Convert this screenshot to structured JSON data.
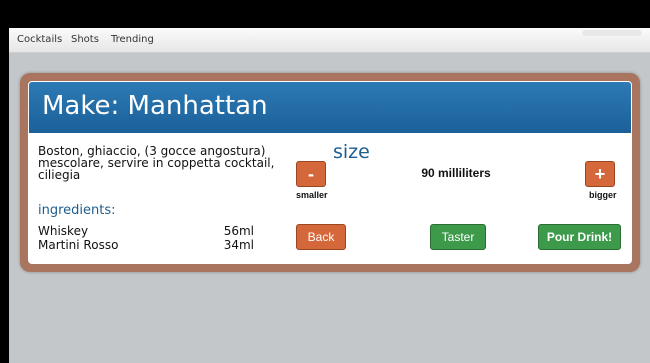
{
  "nav": {
    "items": [
      "Cocktails",
      "Shots",
      "Trending"
    ]
  },
  "drink": {
    "title": "Make: Manhattan",
    "directions": "Boston, ghiaccio, (3 gocce angostura) mescolare, servire in coppetta cocktail, ciliegia",
    "ingredients_heading": "ingredients:",
    "ingredients": [
      {
        "name": "Whiskey",
        "qty": "56ml"
      },
      {
        "name": "Martini Rosso",
        "qty": "34ml"
      }
    ]
  },
  "size": {
    "label": "size",
    "value": "90 milliliters",
    "decrease": {
      "symbol": "-",
      "caption": "smaller"
    },
    "increase": {
      "symbol": "+",
      "caption": "bigger"
    }
  },
  "actions": {
    "back": "Back",
    "taster": "Taster",
    "pour": "Pour Drink!"
  },
  "colors": {
    "header": "#1b6099",
    "panel_border": "#a9755e",
    "orange_button": "#d4683a",
    "green_button": "#3c9a4a",
    "background": "#c4c7c9"
  }
}
